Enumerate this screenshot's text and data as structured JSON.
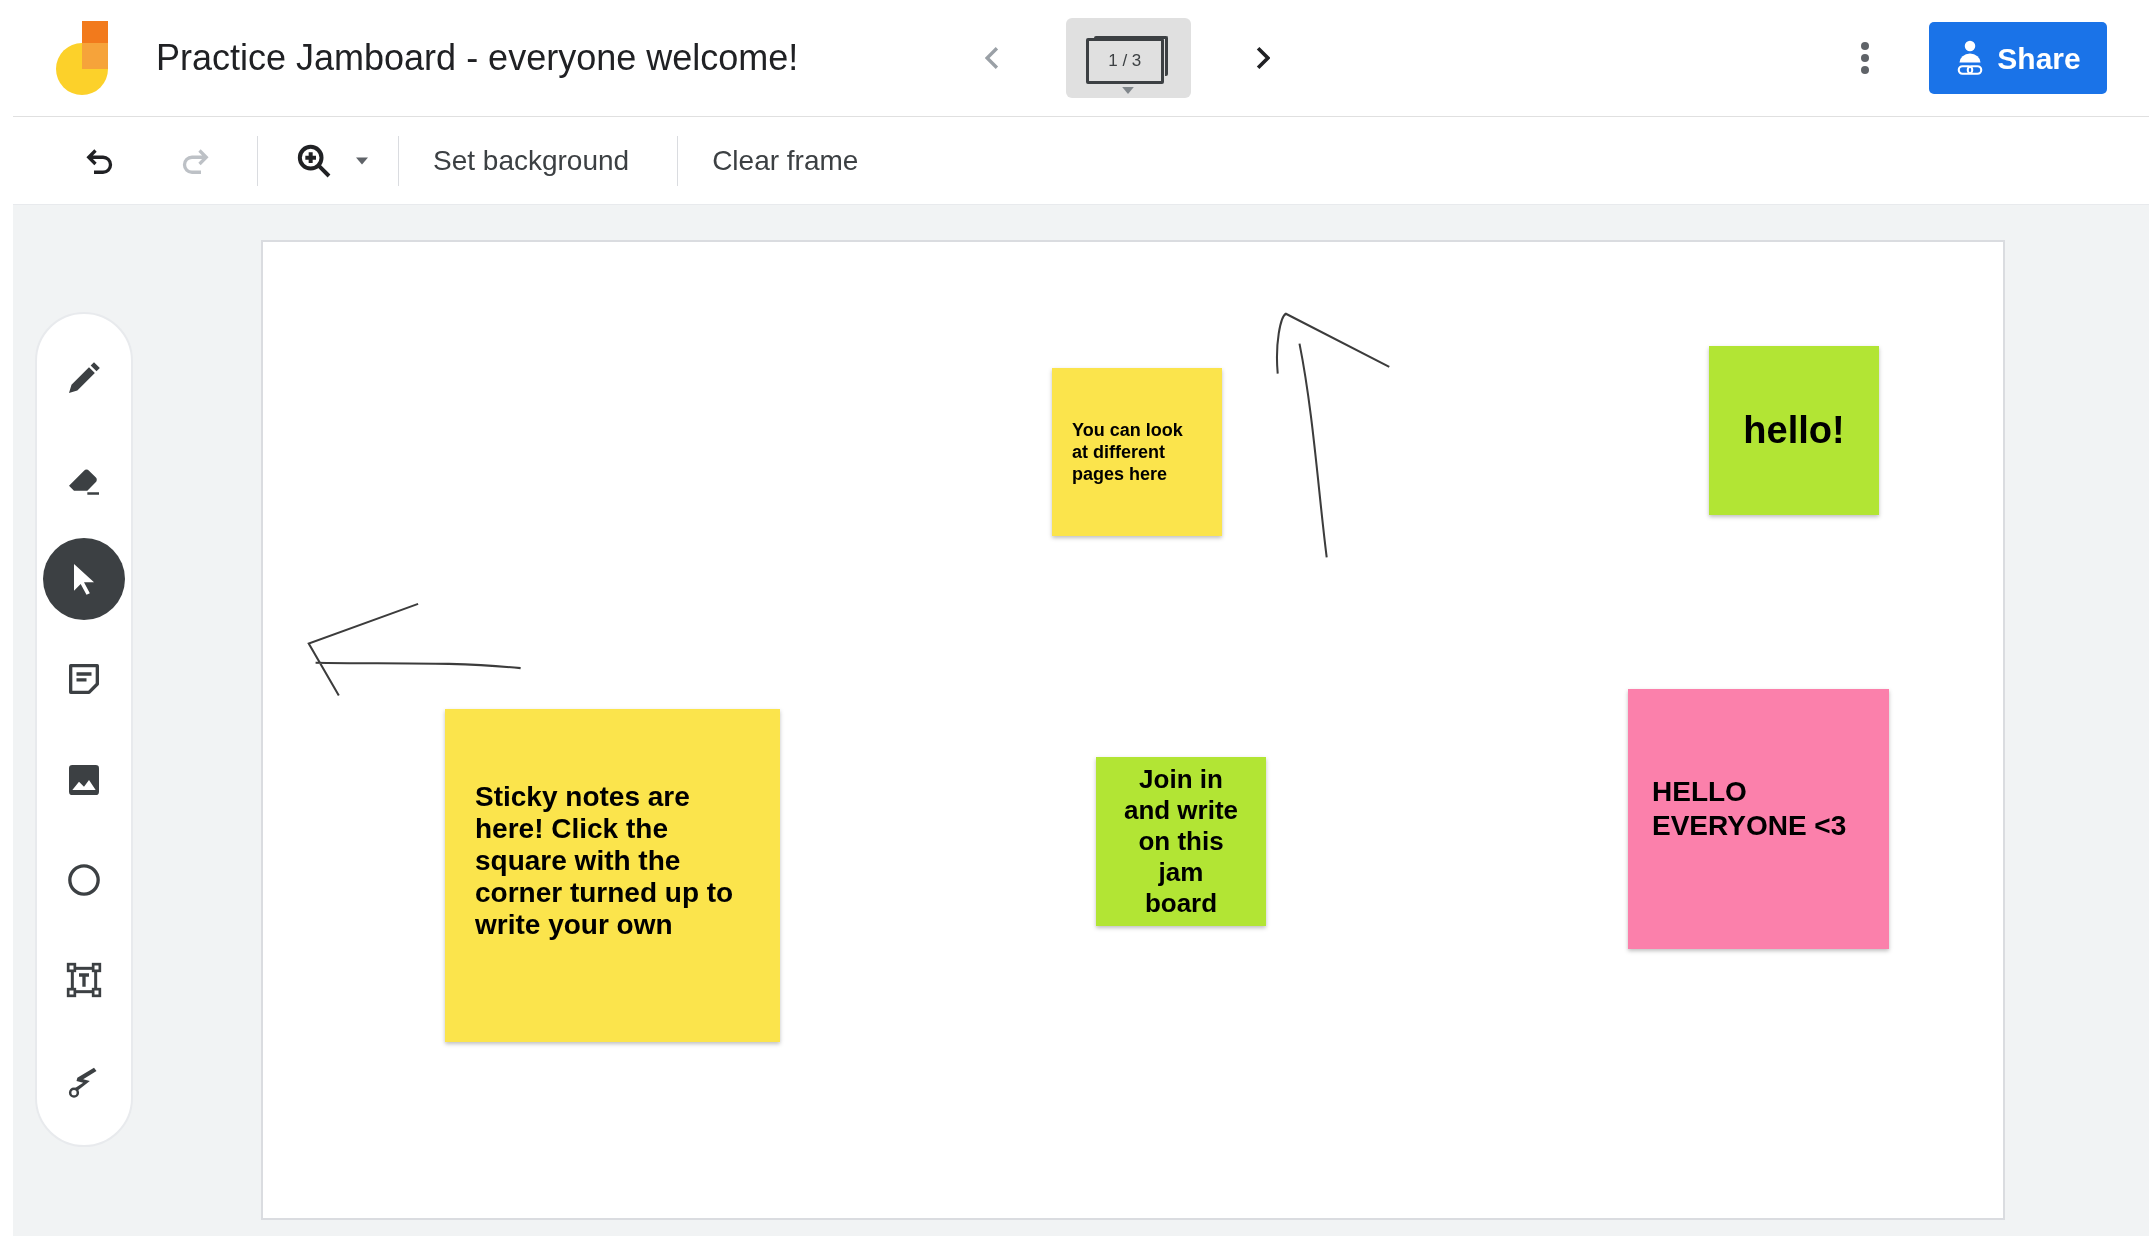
{
  "window": {
    "title": "Practice Jamboard - everyone welcome!"
  },
  "frame_nav": {
    "page_indicator": "1 / 3"
  },
  "share_button": {
    "label": "Share"
  },
  "toolbar": {
    "items": [
      {
        "kind": "undo",
        "disabled": false
      },
      {
        "kind": "redo",
        "disabled": true
      },
      {
        "kind": "zoom",
        "disabled": false
      }
    ],
    "buttons": [
      "Set background",
      "Clear frame"
    ]
  },
  "tools": [
    {
      "kind": "pen",
      "selected": false
    },
    {
      "kind": "eraser",
      "selected": false
    },
    {
      "kind": "select",
      "selected": true
    },
    {
      "kind": "note",
      "selected": false
    },
    {
      "kind": "image",
      "selected": false
    },
    {
      "kind": "circle",
      "selected": false
    },
    {
      "kind": "textbox",
      "selected": false
    },
    {
      "kind": "laser",
      "selected": false
    }
  ],
  "notes": [
    {
      "text": "You can look at different pages here",
      "color": "#fbe44c"
    },
    {
      "text": "hello!",
      "color": "#b2e534"
    },
    {
      "text": "Sticky notes are here! Click the square with the corner turned up to write your own",
      "color": "#fbe44c"
    },
    {
      "text": "Join in and write on this jam board",
      "color": "#b2e534"
    },
    {
      "text": "HELLO EVERYONE <3",
      "color": "#fb80ab"
    }
  ]
}
